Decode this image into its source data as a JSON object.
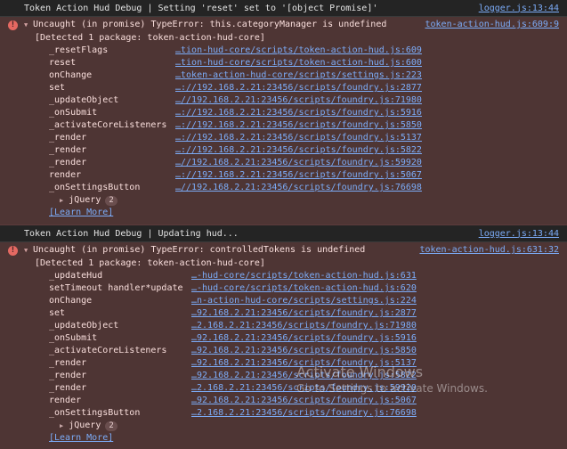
{
  "logs": [
    {
      "message": "Token Action Hud Debug | Setting 'reset' set to '[object Promise]'",
      "source": "logger.js:13:44"
    },
    {
      "message": "Token Action Hud Debug | Updating hud...",
      "source": "logger.js:13:44"
    }
  ],
  "errors": [
    {
      "message": "Uncaught (in promise) TypeError: this.categoryManager is undefined",
      "source": "token-action-hud.js:609:9",
      "detected": "[Detected 1 package: token-action-hud-core]",
      "frames": [
        {
          "fn": "_resetFlags",
          "loc": "…tion-hud-core/scripts/token-action-hud.js:609"
        },
        {
          "fn": "reset",
          "loc": "…tion-hud-core/scripts/token-action-hud.js:600"
        },
        {
          "fn": "onChange",
          "loc": "…token-action-hud-core/scripts/settings.js:223"
        },
        {
          "fn": "set",
          "loc": "…://192.168.2.21:23456/scripts/foundry.js:2877"
        },
        {
          "fn": "_updateObject",
          "loc": "…//192.168.2.21:23456/scripts/foundry.js:71980"
        },
        {
          "fn": "_onSubmit",
          "loc": "…://192.168.2.21:23456/scripts/foundry.js:5916"
        },
        {
          "fn": "_activateCoreListeners",
          "loc": "…://192.168.2.21:23456/scripts/foundry.js:5850"
        },
        {
          "fn": "_render",
          "loc": "…://192.168.2.21:23456/scripts/foundry.js:5137"
        },
        {
          "fn": "_render",
          "loc": "…://192.168.2.21:23456/scripts/foundry.js:5822"
        },
        {
          "fn": "_render",
          "loc": "…//192.168.2.21:23456/scripts/foundry.js:59920"
        },
        {
          "fn": "render",
          "loc": "…://192.168.2.21:23456/scripts/foundry.js:5067"
        },
        {
          "fn": "_onSettingsButton",
          "loc": "…//192.168.2.21:23456/scripts/foundry.js:76698"
        }
      ],
      "jquery_label": "jQuery",
      "jquery_count": "2",
      "learn_more": "[Learn More]"
    },
    {
      "message": "Uncaught (in promise) TypeError: controlledTokens is undefined",
      "source": "token-action-hud.js:631:32",
      "detected": "[Detected 1 package: token-action-hud-core]",
      "frames": [
        {
          "fn": "_updateHud",
          "loc": "…-hud-core/scripts/token-action-hud.js:631"
        },
        {
          "fn": "setTimeout handler*update",
          "loc": "…-hud-core/scripts/token-action-hud.js:620"
        },
        {
          "fn": "onChange",
          "loc": "…n-action-hud-core/scripts/settings.js:224"
        },
        {
          "fn": "set",
          "loc": "…92.168.2.21:23456/scripts/foundry.js:2877"
        },
        {
          "fn": "_updateObject",
          "loc": "…2.168.2.21:23456/scripts/foundry.js:71980"
        },
        {
          "fn": "_onSubmit",
          "loc": "…92.168.2.21:23456/scripts/foundry.js:5916"
        },
        {
          "fn": "_activateCoreListeners",
          "loc": "…92.168.2.21:23456/scripts/foundry.js:5850"
        },
        {
          "fn": "_render",
          "loc": "…92.168.2.21:23456/scripts/foundry.js:5137"
        },
        {
          "fn": "_render",
          "loc": "…92.168.2.21:23456/scripts/foundry.js:5822"
        },
        {
          "fn": "_render",
          "loc": "…2.168.2.21:23456/scripts/foundry.js:59920"
        },
        {
          "fn": "render",
          "loc": "…92.168.2.21:23456/scripts/foundry.js:5067"
        },
        {
          "fn": "_onSettingsButton",
          "loc": "…2.168.2.21:23456/scripts/foundry.js:76698"
        }
      ],
      "jquery_label": "jQuery",
      "jquery_count": "2",
      "learn_more": "[Learn More]"
    }
  ],
  "watermark": {
    "line1": "Activate Windows",
    "line2": "Go to Settings to activate Windows."
  },
  "icons": {
    "error": "error-circle-icon",
    "expand": "triangle-right-icon",
    "collapse": "triangle-down-icon"
  },
  "colors": {
    "error_bg": "#4e3534",
    "link": "#7cacf8",
    "error_icon": "#e46962",
    "console_bg": "#242424"
  }
}
